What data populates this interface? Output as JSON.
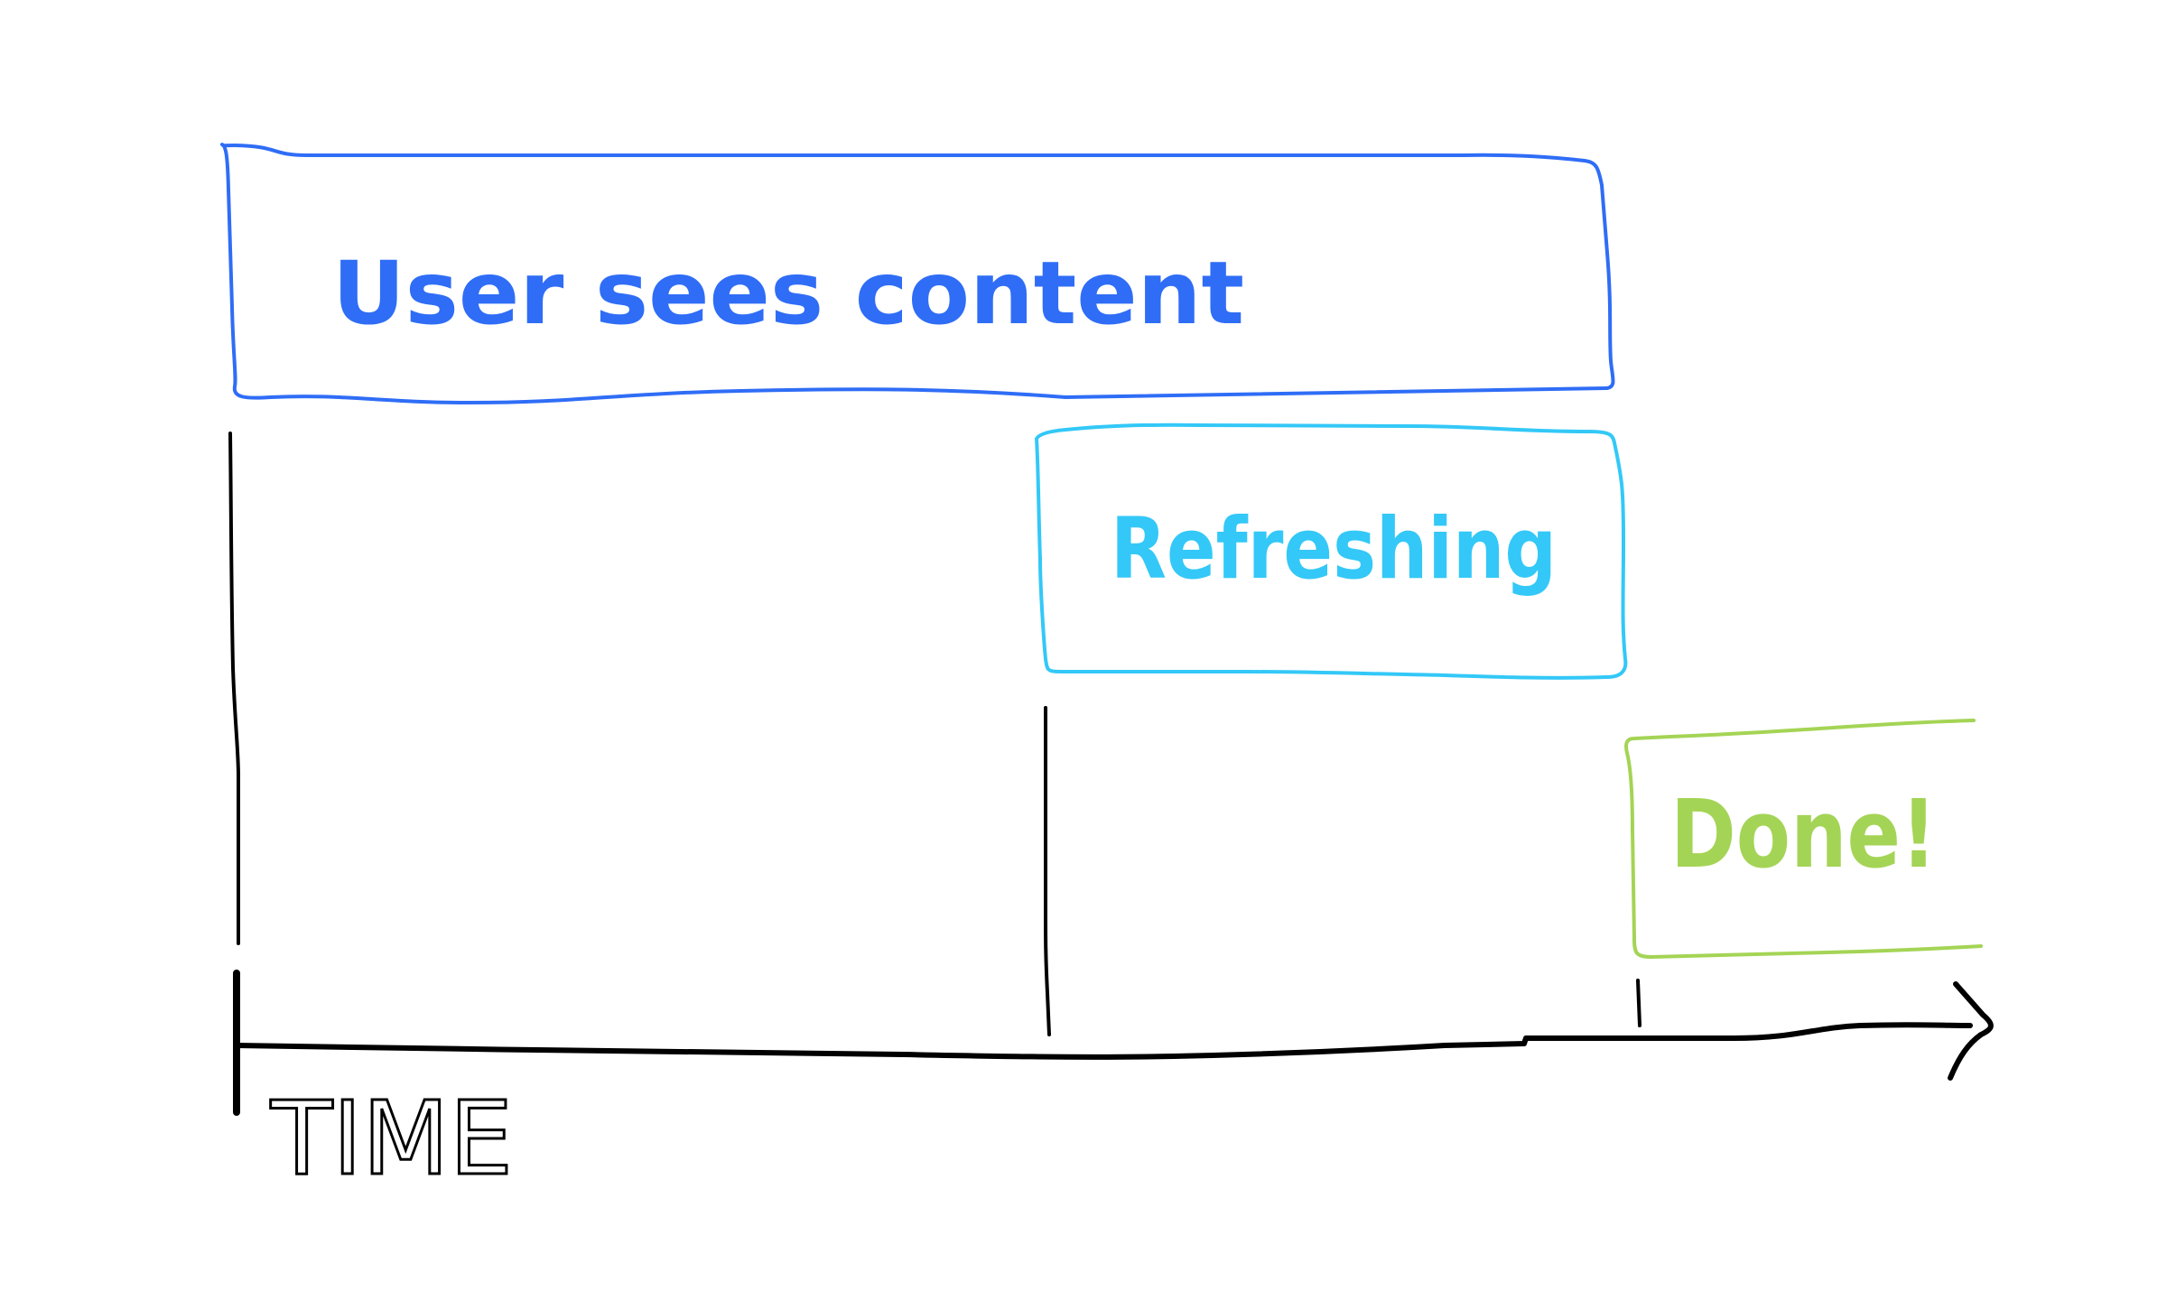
{
  "boxes": [
    {
      "id": "user-sees-content",
      "label": "User sees content",
      "color": "#2f6df6"
    },
    {
      "id": "refreshing",
      "label": "Refreshing",
      "color": "#33c8f7"
    },
    {
      "id": "done",
      "label": "Done!",
      "color": "#a4d455"
    }
  ],
  "axis": {
    "label": "TIME",
    "color": "#000000"
  }
}
